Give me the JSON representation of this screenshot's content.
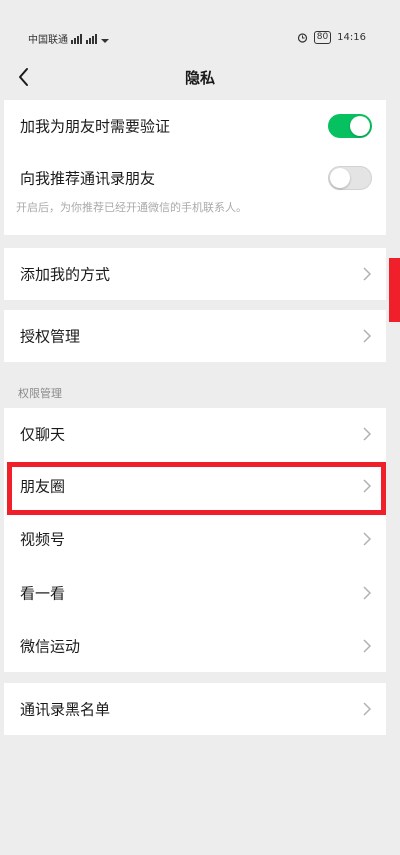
{
  "status_bar": {
    "carrier": "中国联通",
    "time": "14:16",
    "battery": "80"
  },
  "header": {
    "title": "隐私"
  },
  "friend_settings": {
    "verify_label": "加我为朋友时需要验证",
    "verify_on": true,
    "recommend_label": "向我推荐通讯录朋友",
    "recommend_on": false,
    "recommend_hint": "开启后，为你推荐已经开通微信的手机联系人。"
  },
  "add_me": {
    "label": "添加我的方式"
  },
  "authorization": {
    "label": "授权管理"
  },
  "permissions": {
    "section_title": "权限管理",
    "items": [
      {
        "label": "仅聊天"
      },
      {
        "label": "朋友圈"
      },
      {
        "label": "视频号"
      },
      {
        "label": "看一看"
      },
      {
        "label": "微信运动"
      }
    ]
  },
  "blocklist": {
    "label": "通讯录黑名单"
  },
  "colors": {
    "accent_green": "#07c160",
    "highlight_red": "#f0202a"
  },
  "icons": [
    "back-arrow-icon",
    "chevron-right-icon",
    "signal-icon",
    "battery-icon",
    "alarm-icon"
  ]
}
